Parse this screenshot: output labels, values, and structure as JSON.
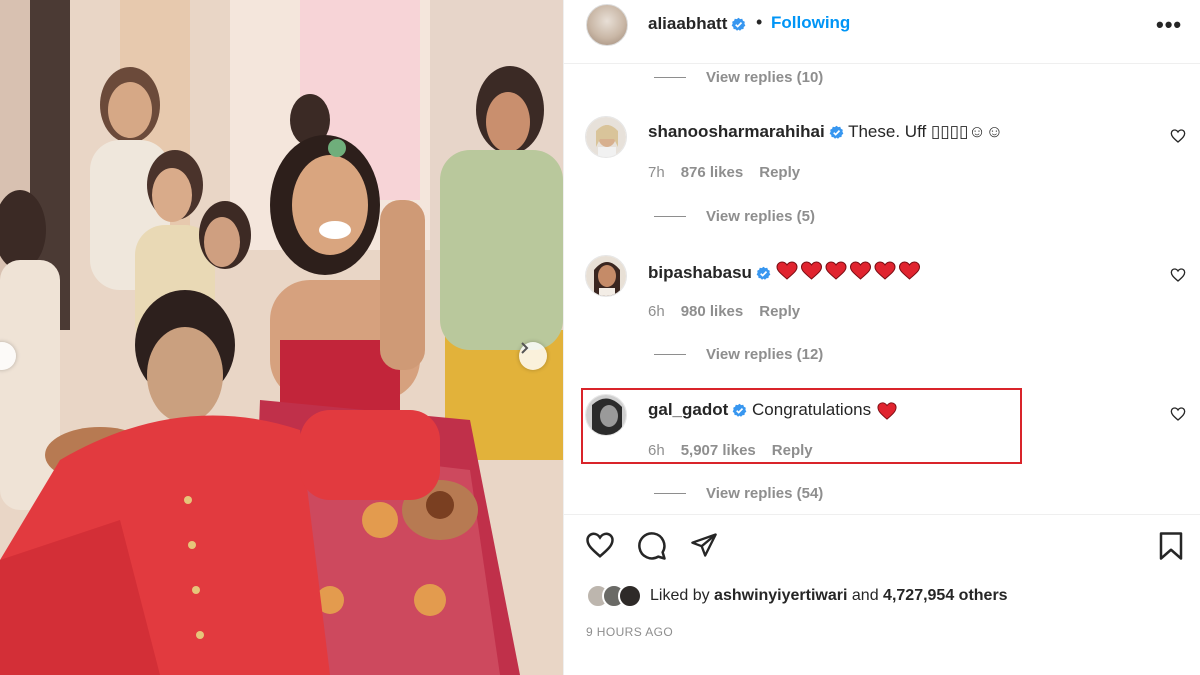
{
  "post": {
    "username": "aliaabhatt",
    "separator": "•",
    "follow_label": "Following",
    "more_label": "•••"
  },
  "replies_top": {
    "label": "View replies (10)"
  },
  "comments": [
    {
      "user": "shanoosharmarahihai",
      "text": "These. Uff ▯▯▯▯☺☺",
      "time": "7h",
      "likes": "876 likes",
      "reply": "Reply",
      "view_replies": "View replies (5)"
    },
    {
      "user": "bipashabasu",
      "text": "",
      "hearts": 6,
      "time": "6h",
      "likes": "980 likes",
      "reply": "Reply",
      "view_replies": "View replies (12)"
    },
    {
      "user": "gal_gadot",
      "text": "Congratulations",
      "hearts": 1,
      "time": "6h",
      "likes": "5,907 likes",
      "reply": "Reply",
      "view_replies": "View replies (54)"
    }
  ],
  "footer": {
    "liked_prefix": "Liked by",
    "liked_user": "ashwinyiyertiwari",
    "liked_and": "and",
    "liked_others": "4,727,954 others",
    "time_ago": "9 HOURS AGO"
  },
  "icons": {
    "verified": "verified-badge-icon",
    "like": "heart-icon",
    "comment": "comment-bubble-icon",
    "share": "paper-plane-icon",
    "save": "bookmark-icon",
    "emoji_heart": "red-heart-emoji"
  },
  "colors": {
    "accent": "#0095f6",
    "verified": "#3897f0",
    "heart_emoji": "#e0242f",
    "highlight": "#d9242a",
    "muted": "#8e8e8e"
  }
}
